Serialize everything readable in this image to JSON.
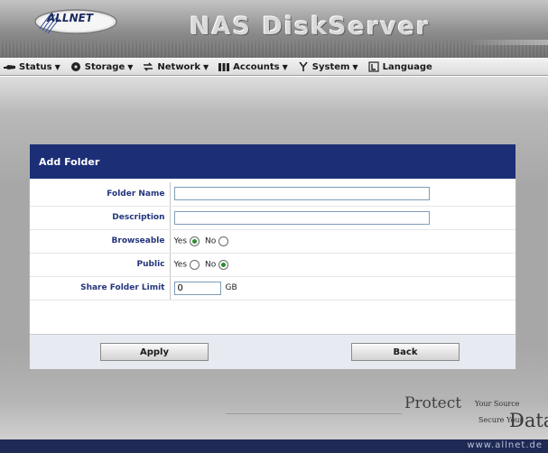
{
  "header": {
    "logo_text": "ALLNET",
    "product_title": "NAS DiskServer"
  },
  "menu": [
    {
      "label": "Status",
      "icon": "status-icon",
      "has_dropdown": true
    },
    {
      "label": "Storage",
      "icon": "storage-icon",
      "has_dropdown": true
    },
    {
      "label": "Network",
      "icon": "network-icon",
      "has_dropdown": true
    },
    {
      "label": "Accounts",
      "icon": "accounts-icon",
      "has_dropdown": true
    },
    {
      "label": "System",
      "icon": "system-icon",
      "has_dropdown": true
    },
    {
      "label": "Language",
      "icon": "language-icon",
      "has_dropdown": false
    }
  ],
  "dialog": {
    "title": "Add Folder",
    "fields": {
      "folder_name": {
        "label": "Folder Name",
        "value": ""
      },
      "description": {
        "label": "Description",
        "value": ""
      },
      "browseable": {
        "label": "Browseable",
        "yes_label": "Yes",
        "no_label": "No",
        "selected": "Yes"
      },
      "public": {
        "label": "Public",
        "yes_label": "Yes",
        "no_label": "No",
        "selected": "No"
      },
      "share_limit": {
        "label": "Share Folder Limit",
        "value": "0",
        "unit": "GB"
      }
    },
    "buttons": {
      "apply": "Apply",
      "back": "Back"
    }
  },
  "tagline": {
    "protect": "Protect",
    "your_source": "Your Source",
    "secure_your": "Secure Your",
    "data": "Data"
  },
  "footer": {
    "url": "www.allnet.de"
  },
  "colors": {
    "dialog_title_bg": "#1c2e76",
    "label_text": "#23357c",
    "footer_bg": "#1f2a55",
    "radio_selected": "#2e8b2e"
  }
}
